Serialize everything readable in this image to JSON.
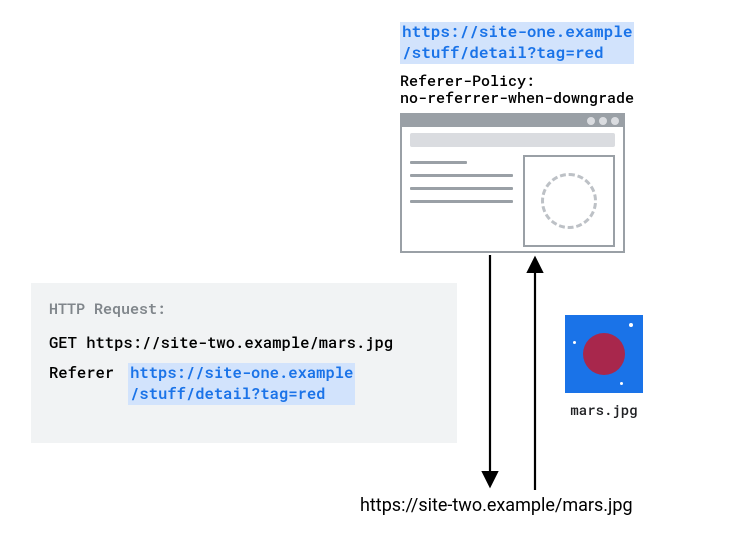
{
  "top_url_line1": "https://site-one.example",
  "top_url_line2": "/stuff/detail?tag=red",
  "policy_line1": "Referer-Policy:",
  "policy_line2": "no-referrer-when-downgrade",
  "request": {
    "title": "HTTP Request:",
    "method_line": "GET https://site-two.example/mars.jpg",
    "referer_label": "Referer",
    "referer_url_line1": "https://site-one.example",
    "referer_url_line2": "/stuff/detail?tag=red"
  },
  "mars_label": "mars.jpg",
  "bottom_url": "https://site-two.example/mars.jpg"
}
